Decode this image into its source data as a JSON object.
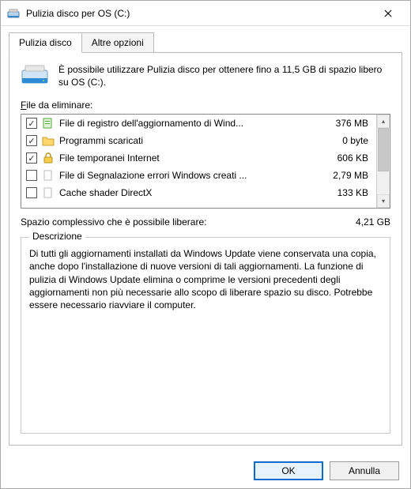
{
  "window": {
    "title": "Pulizia disco per OS (C:)"
  },
  "tabs": {
    "cleanup": "Pulizia disco",
    "options": "Altre opzioni"
  },
  "intro": "È possibile utilizzare Pulizia disco per ottenere fino a 11,5 GB di spazio libero su OS (C:).",
  "files_label": "File da eliminare:",
  "files": [
    {
      "checked": true,
      "icon": "doc-green",
      "name": "File di registro dell'aggiornamento di Wind...",
      "size": "376 MB"
    },
    {
      "checked": true,
      "icon": "folder",
      "name": "Programmi scaricati",
      "size": "0 byte"
    },
    {
      "checked": true,
      "icon": "lock",
      "name": "File temporanei Internet",
      "size": "606 KB"
    },
    {
      "checked": false,
      "icon": "blank",
      "name": "File di Segnalazione errori Windows creati ...",
      "size": "2,79 MB"
    },
    {
      "checked": false,
      "icon": "blank",
      "name": "Cache shader DirectX",
      "size": "133 KB"
    }
  ],
  "total": {
    "label": "Spazio complessivo che è possibile liberare:",
    "value": "4,21 GB"
  },
  "description": {
    "legend": "Descrizione",
    "text": "Di tutti gli aggiornamenti installati da Windows Update viene conservata una copia, anche dopo l'installazione di nuove versioni di tali aggiornamenti. La funzione di pulizia di Windows Update elimina o comprime le versioni precedenti degli aggiornamenti non più necessarie allo scopo di liberare spazio su disco. Potrebbe essere necessario riavviare il computer."
  },
  "buttons": {
    "ok": "OK",
    "cancel": "Annulla"
  }
}
